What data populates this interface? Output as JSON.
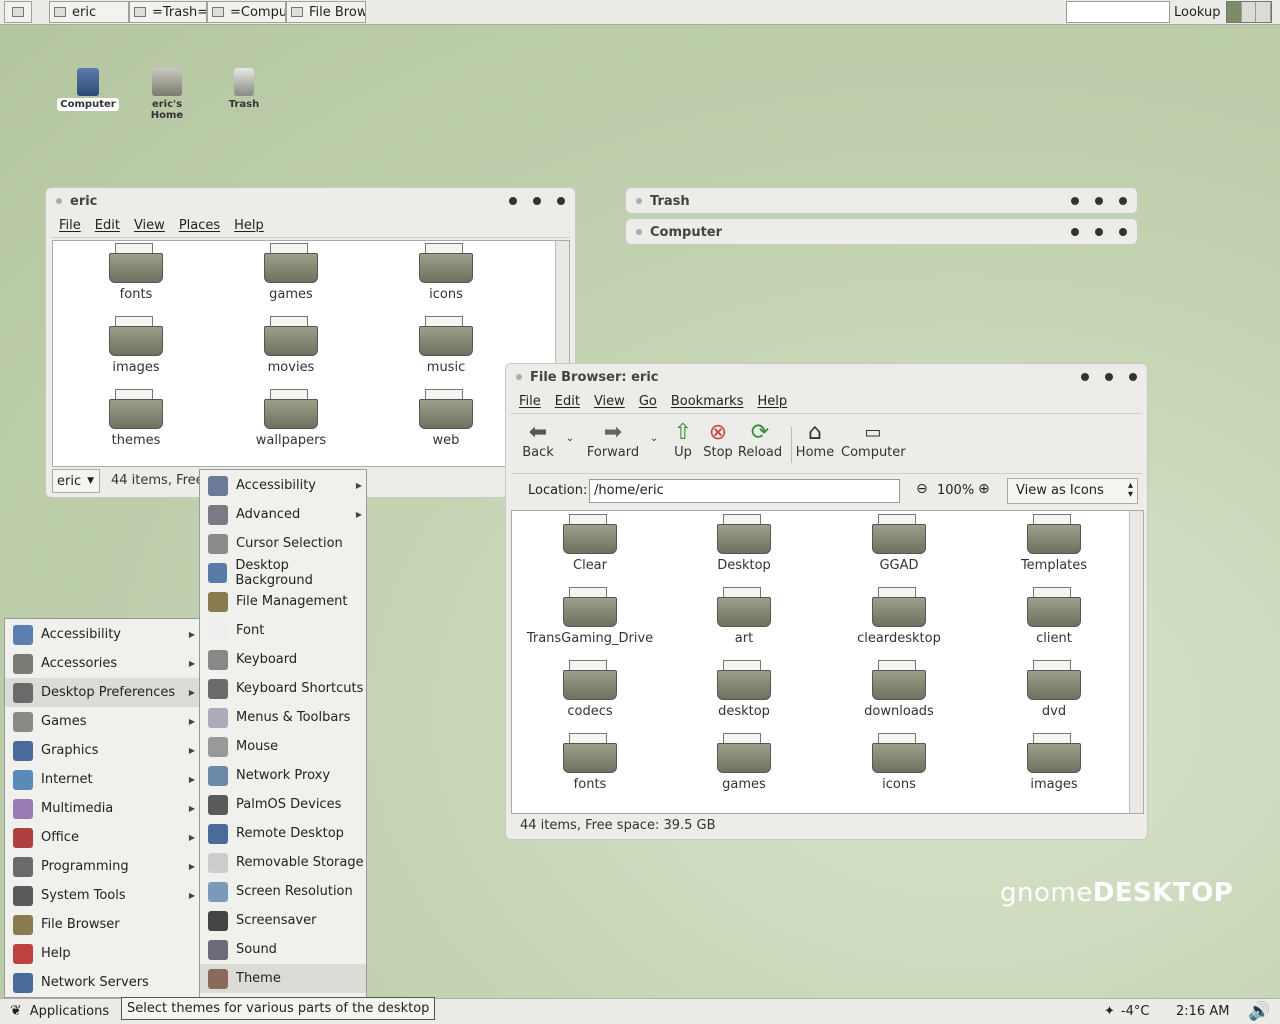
{
  "top_panel": {
    "tasks": [
      "eric",
      "=Trash=",
      "=Comput",
      "File Brow"
    ],
    "lookup_label": "Lookup"
  },
  "desktop_icons": [
    "Computer",
    "eric's Home",
    "Trash"
  ],
  "eric_window": {
    "title": "eric",
    "menu": [
      "File",
      "Edit",
      "View",
      "Places",
      "Help"
    ],
    "folders": [
      "fonts",
      "games",
      "icons",
      "images",
      "movies",
      "music",
      "themes",
      "wallpapers",
      "web"
    ],
    "location_combo": "eric",
    "status": "44 items, Free"
  },
  "shaded_windows": [
    "Trash",
    "Computer"
  ],
  "browser_window": {
    "title": "File Browser: eric",
    "menu": [
      "File",
      "Edit",
      "View",
      "Go",
      "Bookmarks",
      "Help"
    ],
    "toolbar": {
      "back": "Back",
      "forward": "Forward",
      "up": "Up",
      "stop": "Stop",
      "reload": "Reload",
      "home": "Home",
      "computer": "Computer"
    },
    "location_label": "Location:",
    "location_value": "/home/eric",
    "zoom": "100%",
    "view_mode": "View as Icons",
    "folders": [
      "Clear",
      "Desktop",
      "GGAD",
      "Templates",
      "TransGaming_Drive",
      "art",
      "cleardesktop",
      "client",
      "codecs",
      "desktop",
      "downloads",
      "dvd",
      "fonts",
      "games",
      "icons",
      "images"
    ],
    "status": "44 items, Free space: 39.5 GB"
  },
  "app_menu": {
    "items": [
      {
        "label": "Accessibility",
        "icon": "accessibility-icon",
        "submenu": true
      },
      {
        "label": "Accessories",
        "icon": "accessories-icon",
        "submenu": true
      },
      {
        "label": "Desktop Preferences",
        "icon": "preferences-icon",
        "submenu": true
      },
      {
        "label": "Games",
        "icon": "games-icon",
        "submenu": true
      },
      {
        "label": "Graphics",
        "icon": "graphics-icon",
        "submenu": true
      },
      {
        "label": "Internet",
        "icon": "internet-icon",
        "submenu": true
      },
      {
        "label": "Multimedia",
        "icon": "multimedia-icon",
        "submenu": true
      },
      {
        "label": "Office",
        "icon": "office-icon",
        "submenu": true
      },
      {
        "label": "Programming",
        "icon": "programming-icon",
        "submenu": true
      },
      {
        "label": "System Tools",
        "icon": "system-tools-icon",
        "submenu": true
      },
      {
        "label": "File Browser",
        "icon": "file-browser-icon",
        "submenu": false
      },
      {
        "label": "Help",
        "icon": "help-icon",
        "submenu": false
      },
      {
        "label": "Network Servers",
        "icon": "network-icon",
        "submenu": false
      }
    ]
  },
  "prefs_menu": {
    "items": [
      {
        "label": "Accessibility",
        "submenu": true
      },
      {
        "label": "Advanced",
        "submenu": true
      },
      {
        "label": "Cursor Selection",
        "submenu": false
      },
      {
        "label": "Desktop Background",
        "submenu": false
      },
      {
        "label": "File Management",
        "submenu": false
      },
      {
        "label": "Font",
        "submenu": false
      },
      {
        "label": "Keyboard",
        "submenu": false
      },
      {
        "label": "Keyboard Shortcuts",
        "submenu": false
      },
      {
        "label": "Menus & Toolbars",
        "submenu": false
      },
      {
        "label": "Mouse",
        "submenu": false
      },
      {
        "label": "Network Proxy",
        "submenu": false
      },
      {
        "label": "PalmOS Devices",
        "submenu": false
      },
      {
        "label": "Remote Desktop",
        "submenu": false
      },
      {
        "label": "Removable Storage",
        "submenu": false
      },
      {
        "label": "Screen Resolution",
        "submenu": false
      },
      {
        "label": "Screensaver",
        "submenu": false
      },
      {
        "label": "Sound",
        "submenu": false
      },
      {
        "label": "Theme",
        "submenu": false
      }
    ]
  },
  "bottom_panel": {
    "applications_label": "Applications",
    "tooltip": "Select themes for various parts of the desktop",
    "weather": "-4°C",
    "clock": "2:16 AM"
  },
  "logo": {
    "prefix": "gnome",
    "suffix": "DESKTOP"
  }
}
